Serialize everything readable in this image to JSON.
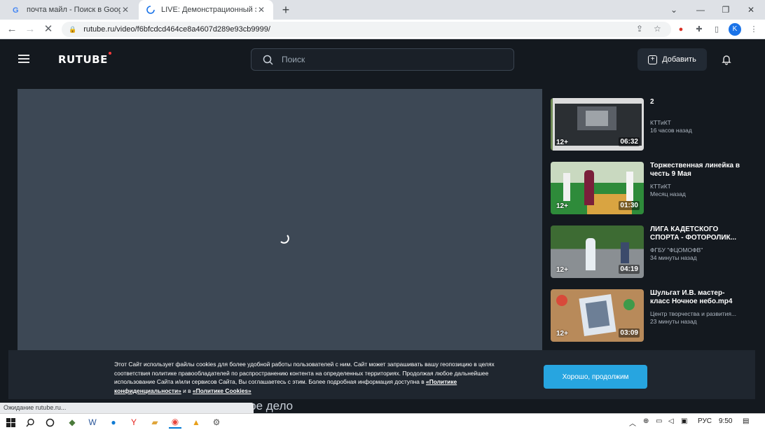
{
  "browser": {
    "tabs": [
      {
        "title": "почта майл - Поиск в Google",
        "icon": "google-icon"
      },
      {
        "title": "LIVE: Демонстрационный экзам",
        "icon": "loading-icon"
      }
    ],
    "url": "rutube.ru/video/f6bfcdcd464ce8a4607d289e93cb9999/",
    "profile_initial": "K",
    "status_text": "Ожидание rutube.ru..."
  },
  "header": {
    "logo": "RUTUBE",
    "search_placeholder": "Поиск",
    "add_label": "Добавить"
  },
  "sidebar": {
    "videos": [
      {
        "title": "2",
        "channel": "КТТиКТ",
        "time": "16 часов назад",
        "age": "12+",
        "duration": "06:32"
      },
      {
        "title": "Торжественная линейка в честь 9 Мая",
        "channel": "КТТиКТ",
        "time": "Месяц назад",
        "age": "12+",
        "duration": "01:30"
      },
      {
        "title": "ЛИГА КАДЕТСКОГО СПОРТА - ФОТОРОЛИК...",
        "channel": "ФГБУ \"ФЦОМОФВ\"",
        "time": "34 минуты назад",
        "age": "12+",
        "duration": "04:19"
      },
      {
        "title": "Шульгат И.В. мастер-класс Ночное небо.mp4",
        "channel": "Центр творчества и развития...",
        "time": "23 минуты назад",
        "age": "12+",
        "duration": "03:09"
      }
    ]
  },
  "below_title_fragment": "ское дело",
  "cookie": {
    "text_main": "Этот Сайт использует файлы cookies для более удобной работы пользователей с ним. Сайт может запрашивать вашу геопозицию в целях соответствия политике правообладателей по распространению контента на определенных территориях. Продолжая любое дальнейшее использование Сайта и/или сервисов Сайта, Вы соглашаетесь с этим. Более подробная информация доступна в ",
    "link1": "«Политике конфиденциальности»",
    "and": " и в ",
    "link2": "«Политике Cookies»",
    "button": "Хорошо, продолжим"
  },
  "taskbar": {
    "lang": "РУС",
    "time": "9:50"
  }
}
